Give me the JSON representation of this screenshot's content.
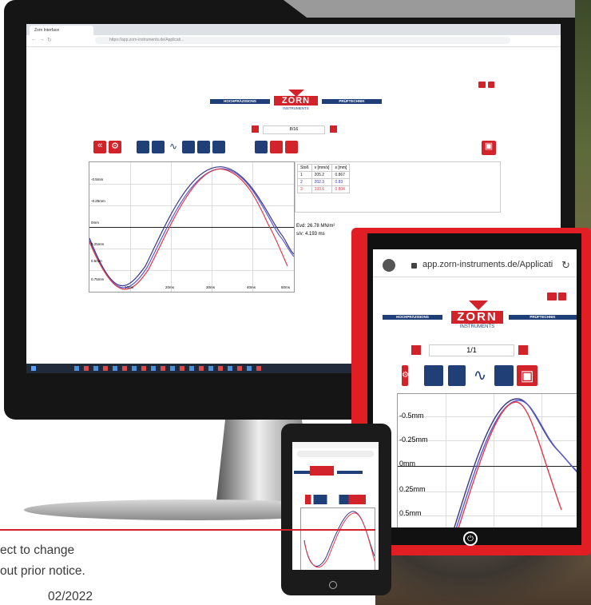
{
  "desktop": {
    "tab_title": "Zorn Interface",
    "url": "https://app.zorn-instruments.de/Applicati...",
    "logo": {
      "left_bar": "HOCHPRÄZISIONS",
      "brand": "ZORN",
      "sub": "INSTRUMENTS",
      "right_bar": "PRÜFTECHNIK"
    },
    "pager": "8/16",
    "table": {
      "headers": [
        "Stoß",
        "v [mm/s]",
        "s [mm]"
      ],
      "rows": [
        [
          "1",
          "205.2",
          "0.867"
        ],
        [
          "2",
          "202.3",
          "0.83"
        ],
        [
          "3",
          "193.6",
          "0.804"
        ]
      ]
    },
    "results": {
      "evd": "Evd: 26.78 MN/m²",
      "sv": "s/v: 4.193 ms"
    },
    "y_labels": [
      "-0.5mm",
      "-0.25mm",
      "0mm",
      "0.25mm",
      "0.5mm",
      "0.75mm"
    ],
    "x_labels": [
      "10ms",
      "20ms",
      "30ms",
      "40ms",
      "50ms"
    ]
  },
  "tablet": {
    "url": "app.zorn-instruments.de/Applicati",
    "pager": "1/1",
    "logo": {
      "left_bar": "HOCHPRÄZISIONS",
      "brand": "ZORN",
      "sub": "INSTRUMENTS",
      "right_bar": "PRÜFTECHNIK"
    },
    "y_labels": [
      "-0.5mm",
      "-0.25mm",
      "0mm",
      "0.25mm",
      "0.5mm"
    ]
  },
  "footer": {
    "line1": "ect to change",
    "line2": "out prior notice.",
    "line3": "02/2022"
  },
  "colors": {
    "brand_red": "#d3232a",
    "brand_blue": "#1e3f78",
    "series1": "#3a3a8a",
    "series2": "#5a5ad0",
    "series3": "#e03a4a"
  }
}
